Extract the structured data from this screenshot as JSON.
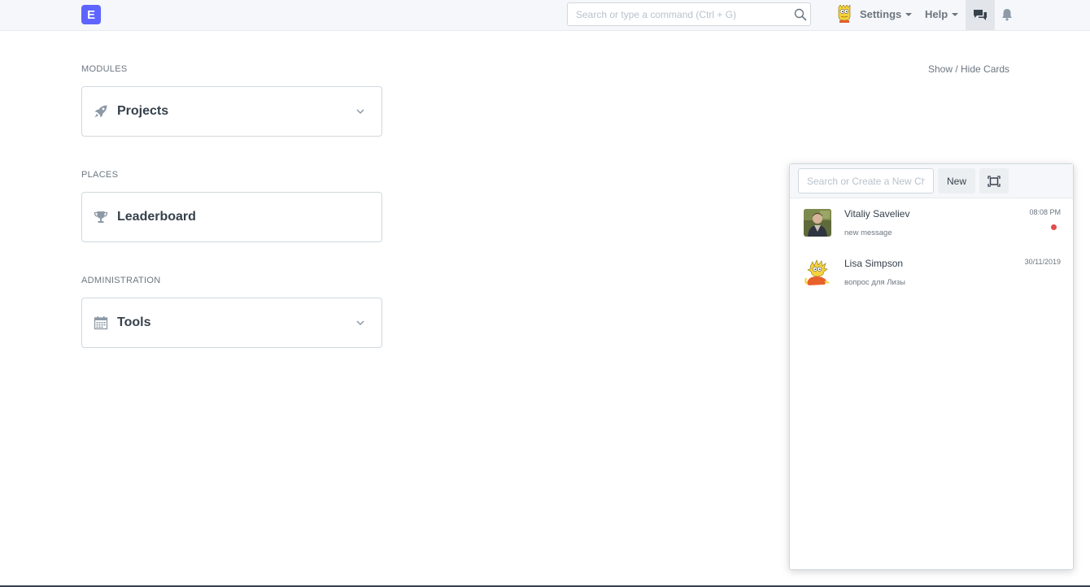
{
  "navbar": {
    "brand_letter": "E",
    "search": {
      "placeholder": "Search or type a command (Ctrl + G)",
      "value": ""
    },
    "settings_label": "Settings",
    "help_label": "Help",
    "icons": {
      "search": "search-icon",
      "chat": "chat-icon",
      "bell": "bell-icon"
    }
  },
  "desk": {
    "show_hide_label": "Show / Hide Cards",
    "sections": [
      {
        "label": "MODULES",
        "card": {
          "label": "Projects",
          "icon": "rocket-icon",
          "expandable": true
        }
      },
      {
        "label": "PLACES",
        "card": {
          "label": "Leaderboard",
          "icon": "trophy-icon",
          "expandable": false
        }
      },
      {
        "label": "ADMINISTRATION",
        "card": {
          "label": "Tools",
          "icon": "calendar-icon",
          "expandable": true
        }
      }
    ]
  },
  "chat": {
    "search_placeholder": "Search or Create a New Chat",
    "search_value": "",
    "new_label": "New",
    "rooms": [
      {
        "name": "Vitaliy Saveliev",
        "last_message": "new message",
        "time": "08:08 PM",
        "unread": true
      },
      {
        "name": "Lisa Simpson",
        "last_message": "вопрос для Лизы",
        "time": "30/11/2019",
        "unread": false
      }
    ]
  },
  "colors": {
    "brand": "#5e64ff",
    "navbar_bg": "#f5f7fa",
    "text": "#36414c",
    "muted_text": "#6c7680",
    "border": "#d1d8dd",
    "unread_dot": "#e24c4c"
  }
}
